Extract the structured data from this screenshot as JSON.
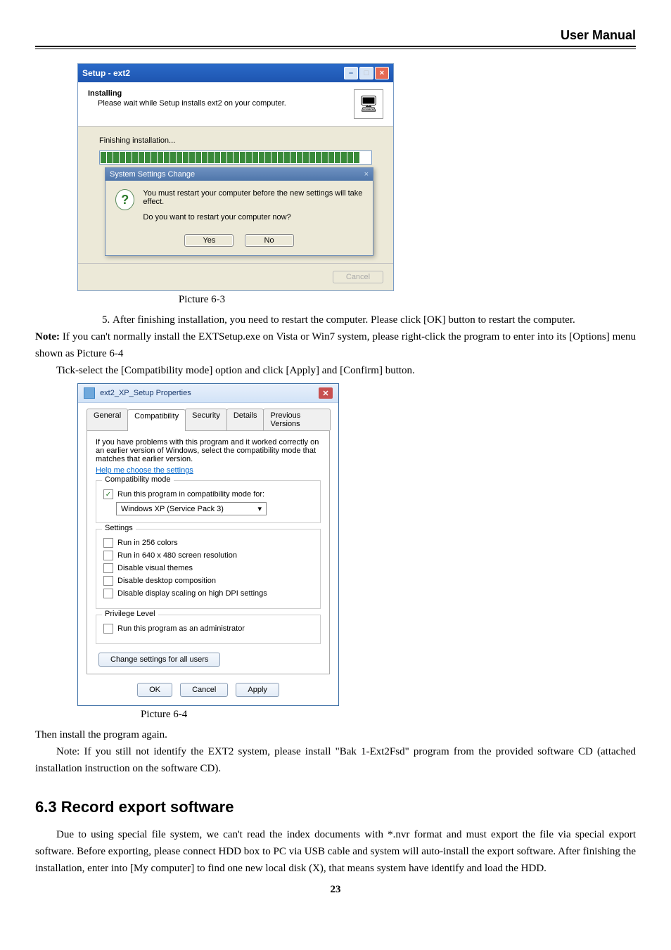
{
  "header": {
    "title": "User Manual"
  },
  "pic63": {
    "window_title": "Setup - ext2",
    "heading": "Installing",
    "subtext": "Please wait while Setup installs ext2 on your computer.",
    "status": "Finishing installation...",
    "msgbox_title": "System Settings Change",
    "msg_line1": "You must restart your computer before the new settings will take effect.",
    "msg_line2": "Do you want to restart your computer now?",
    "yes": "Yes",
    "no": "No",
    "cancel": "Cancel",
    "caption": "Picture 6-3"
  },
  "body1": {
    "step5": "After finishing installation, you need to restart the computer. Please click [OK] button to restart the computer.",
    "note": "Note: If you can't normally install the EXTSetup.exe on Vista or Win7 system, please right-click the program to enter into its [Options] menu shown as Picture 6-4",
    "tick": "Tick-select the [Compatibility mode] option and click [Apply] and [Confirm] button."
  },
  "pic64": {
    "title": "ext2_XP_Setup Properties",
    "tabs": {
      "general": "General",
      "compat": "Compatibility",
      "security": "Security",
      "details": "Details",
      "prev": "Previous Versions"
    },
    "intro": "If you have problems with this program and it worked correctly on an earlier version of Windows, select the compatibility mode that matches that earlier version.",
    "help_link": "Help me choose the settings",
    "group_compat": "Compatibility mode",
    "run_compat": "Run this program in compatibility mode for:",
    "compat_value": "Windows XP (Service Pack 3)",
    "group_settings": "Settings",
    "s1": "Run in 256 colors",
    "s2": "Run in 640 x 480 screen resolution",
    "s3": "Disable visual themes",
    "s4": "Disable desktop composition",
    "s5": "Disable display scaling on high DPI settings",
    "group_priv": "Privilege Level",
    "priv1": "Run this program as an administrator",
    "change_all": "Change settings for all users",
    "ok": "OK",
    "cancel": "Cancel",
    "apply": "Apply",
    "caption": "Picture 6-4"
  },
  "body2": {
    "then": "Then install the program again.",
    "note2": "Note: If you still not identify the EXT2 system, please install \"Bak 1-Ext2Fsd\" program from the provided software CD (attached installation instruction on the software CD)."
  },
  "section": {
    "heading": "6.3 Record export software",
    "para": "Due to using special file system, we can't read the index documents with *.nvr format and must export the file via special export software. Before exporting, please connect HDD box to PC via USB cable and system will auto-install the export software. After finishing the installation, enter into [My computer] to find one new local disk (X), that means system have identify and load the HDD."
  },
  "page_num": "23"
}
